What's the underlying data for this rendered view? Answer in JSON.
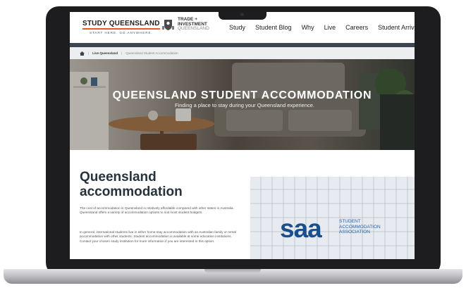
{
  "header": {
    "logo_title": "STUDY QUEENSLAND",
    "logo_tagline": "START HERE. GO ANYWHERE.",
    "partner_line1": "TRADE +",
    "partner_line2": "INVESTMENT",
    "partner_line3": "QUEENSLAND",
    "nav": [
      "Study",
      "Student Blog",
      "Why",
      "Live",
      "Careers",
      "Student Arrivals"
    ]
  },
  "breadcrumb": {
    "home_icon": "home-icon",
    "separator": "|",
    "parent": "Live Queensland",
    "current": "Queensland Student Accommodation"
  },
  "hero": {
    "title": "QUEENSLAND STUDENT ACCOMMODATION",
    "subtitle": "Finding a place to stay during your Queensland experience."
  },
  "main": {
    "heading": "Queensland accommodation",
    "paragraph1": "The cost of accommodation in Queensland is relatively affordable compared with other states in Australia. Queensland offers a variety of accommodation options to suit most student budgets.",
    "paragraph2": "In general, international students live in either home-stay accommodation with an Australian family or rental accommodation with other students. Student accommodation is available at some education institutions. Contact your chosen study institution for more information if you are interested in this option."
  },
  "saa": {
    "logo": "saa",
    "line1": "STUDENT",
    "line2": "ACCOMMODATION",
    "line3": "ASSOCIATION"
  },
  "colors": {
    "accent": "#e05b26",
    "nav_bar": "#3d4650",
    "heading": "#26323d",
    "saa_blue": "#184f8f"
  }
}
